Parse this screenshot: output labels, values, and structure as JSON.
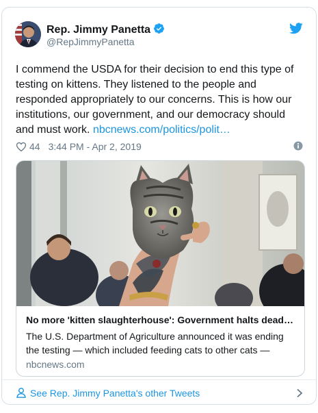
{
  "tweet": {
    "author_name": "Rep. Jimmy Panetta",
    "author_handle": "@RepJimmyPanetta",
    "text": "I commend the USDA for their decision to end this type of testing on kittens. They listened to the people and responded appropriately to our concerns. This is how our institutions, our government, and our democracy should and must work.",
    "link_text": "nbcnews.com/politics/polit…",
    "like_count": "44",
    "timestamp": "3:44 PM - Apr 2, 2019"
  },
  "link_card": {
    "title": "No more 'kitten slaughterhouse': Government halts dead…",
    "description": "The U.S. Department of Agriculture announced it was ending the testing — which included feeding cats to other cats —",
    "domain": "nbcnews.com"
  },
  "footer": {
    "see_more_label": "See Rep. Jimmy Panetta's other Tweets"
  },
  "icons": {
    "verified": "verified-badge-icon",
    "brand": "twitter-bird-icon",
    "like": "heart-icon",
    "info": "info-icon",
    "profile": "person-icon",
    "next": "chevron-right-icon"
  },
  "colors": {
    "link": "#1b95e0",
    "verified": "#1da1f2",
    "secondary_text": "#657786",
    "border": "#d5dfe6"
  }
}
